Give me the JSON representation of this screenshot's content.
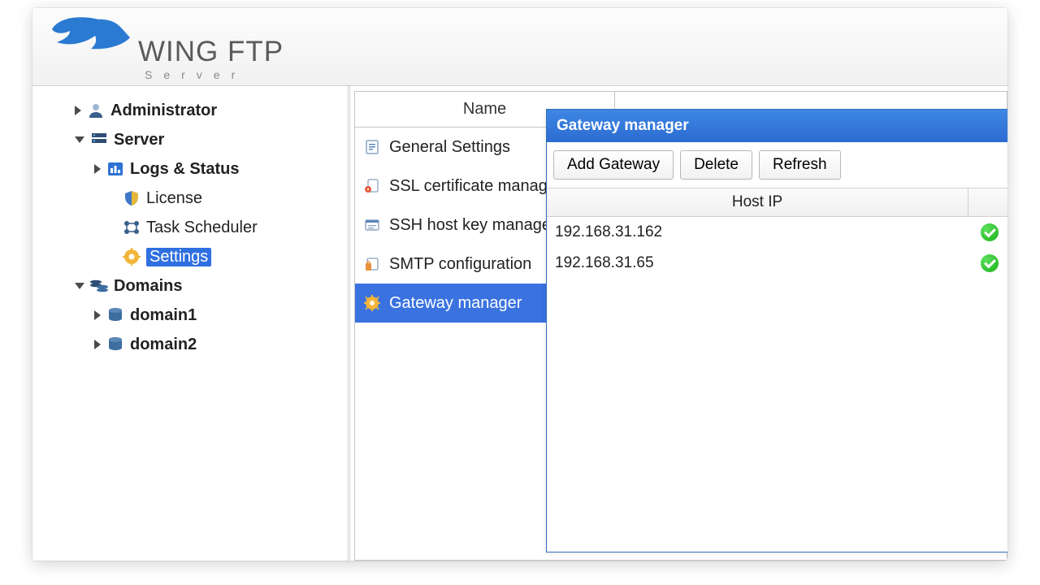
{
  "app": {
    "title": "WING FTP",
    "subtitle": "Server"
  },
  "tree": {
    "administrator": "Administrator",
    "server": "Server",
    "logs_status": "Logs & Status",
    "license": "License",
    "task_scheduler": "Task Scheduler",
    "settings": "Settings",
    "domains": "Domains",
    "domain1": "domain1",
    "domain2": "domain2"
  },
  "list": {
    "col_name": "Name",
    "items": [
      "General Settings",
      "SSL certificate manager",
      "SSH host key manager",
      "SMTP configuration",
      "Gateway manager"
    ],
    "selected_index": 4
  },
  "dialog": {
    "title": "Gateway manager",
    "buttons": {
      "add": "Add Gateway",
      "delete": "Delete",
      "refresh": "Refresh"
    },
    "col_host": "Host IP",
    "rows": [
      {
        "host": "192.168.31.162",
        "ok": true
      },
      {
        "host": "192.168.31.65",
        "ok": true
      }
    ]
  }
}
